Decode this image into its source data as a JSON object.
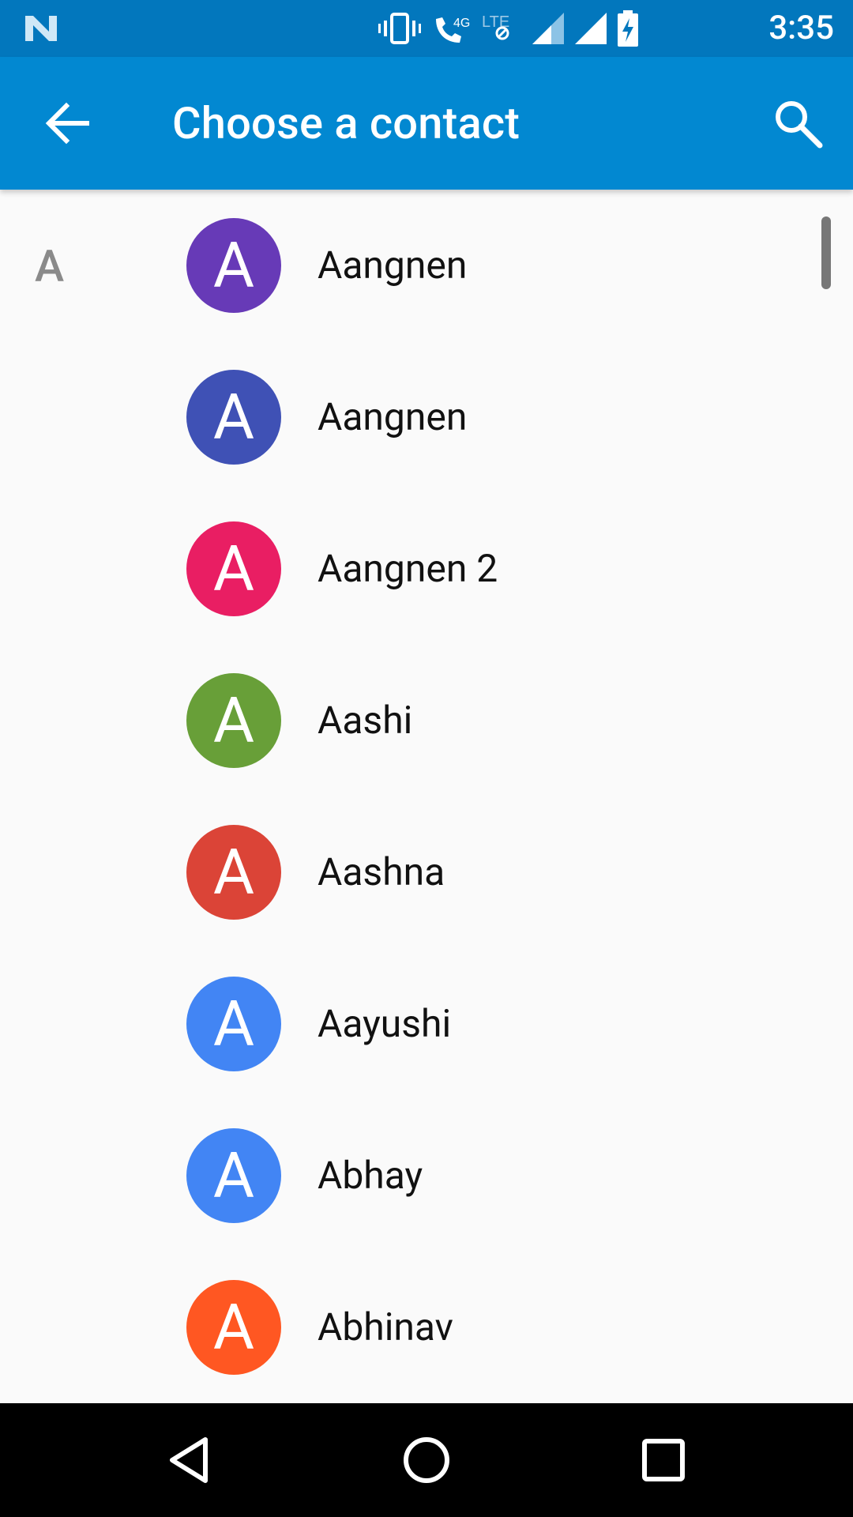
{
  "status_bar": {
    "time": "3:35",
    "network": "4G",
    "network2": "LTE"
  },
  "app_bar": {
    "title": "Choose a contact"
  },
  "section": {
    "letter": "A"
  },
  "contacts": [
    {
      "name": "Aangnen",
      "initial": "A",
      "color": "#673ab7"
    },
    {
      "name": "Aangnen",
      "initial": "A",
      "color": "#3f51b5"
    },
    {
      "name": "Aangnen 2",
      "initial": "A",
      "color": "#e91e63"
    },
    {
      "name": "Aashi",
      "initial": "A",
      "color": "#689f38"
    },
    {
      "name": "Aashna",
      "initial": "A",
      "color": "#db4437"
    },
    {
      "name": "Aayushi",
      "initial": "A",
      "color": "#4285f4"
    },
    {
      "name": "Abhay",
      "initial": "A",
      "color": "#4285f4"
    },
    {
      "name": "Abhinav",
      "initial": "A",
      "color": "#ff5722"
    }
  ],
  "colors": {
    "status_bar": "#0277bd",
    "app_bar": "#0288d1",
    "background": "#fafafa"
  }
}
